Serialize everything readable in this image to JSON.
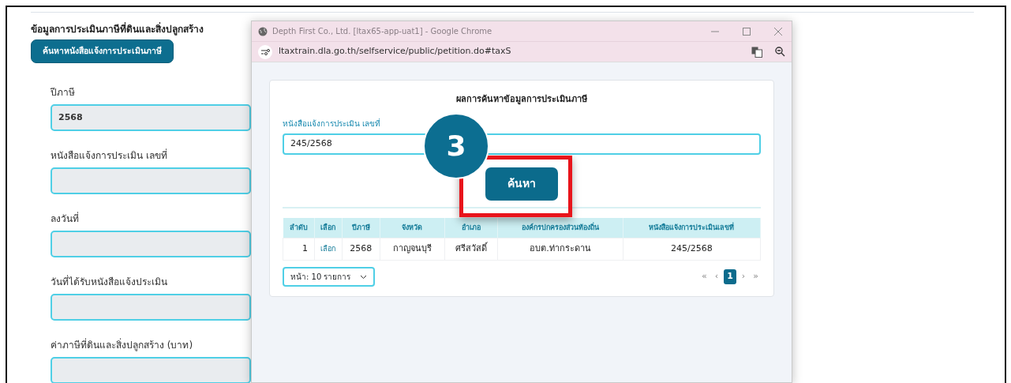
{
  "page": {
    "section_title": "ข้อมูลการประเมินภาษีที่ดินและสิ่งปลูกสร้าง",
    "search_button": "ค้นหาหนังสือแจ้งการประเมินภาษี",
    "fields": [
      {
        "label": "ปีภาษี",
        "value": "2568"
      },
      {
        "label": "หนังสือแจ้งการประเมิน เลขที่"
      },
      {
        "label": "ลงวันที่"
      },
      {
        "label": "วันที่ได้รับหนังสือแจ้งประเมิน"
      },
      {
        "label": "ค่าภาษีที่ดินและสิ่งปลูกสร้าง (บาท)"
      }
    ]
  },
  "popup": {
    "window_title": "Depth First Co., Ltd. [ltax65-app-uat1] - Google Chrome",
    "url": "ltaxtrain.dla.go.th/selfservice/public/petition.do#taxS",
    "card_title": "ผลการค้นหาข้อมูลการประเมินภาษี",
    "field_label": "หนังสือแจ้งการประเมิน เลขที่",
    "field_value": "245/2568",
    "search_button": "ค้นหา",
    "table": {
      "columns": [
        "ลำดับ",
        "เลือก",
        "ปีภาษี",
        "จังหวัด",
        "อำเภอ",
        "องค์กรปกครองส่วนท้องถิ่น",
        "หนังสือแจ้งการประเมินเลขที่"
      ],
      "rows": [
        {
          "cells": [
            "1",
            "เลือก",
            "2568",
            "กาญจนบุรี",
            "ศรีสวัสดิ์",
            "อบต.ท่ากระดาน",
            "245/2568"
          ]
        }
      ]
    },
    "page_size": "หน้า: 10 รายการ",
    "pagination": [
      {
        "label": "«",
        "selected": false
      },
      {
        "label": "‹",
        "selected": false
      },
      {
        "label": "1",
        "selected": true
      },
      {
        "label": "›",
        "selected": false
      },
      {
        "label": "»",
        "selected": false
      }
    ]
  },
  "step_badge": "3"
}
